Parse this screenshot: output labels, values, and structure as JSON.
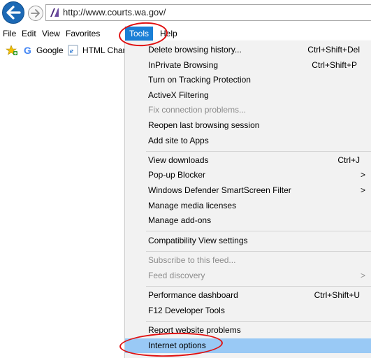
{
  "address_bar": {
    "url": "http://www.courts.wa.gov/",
    "back_icon": "back-arrow-icon",
    "forward_icon": "forward-arrow-icon",
    "site_icon": "site-favicon-icon"
  },
  "menu_bar": {
    "items": [
      {
        "label": "File"
      },
      {
        "label": "Edit"
      },
      {
        "label": "View"
      },
      {
        "label": "Favorites"
      },
      {
        "label": "Tools"
      },
      {
        "label": "Help"
      }
    ],
    "active": "Tools"
  },
  "favorites_bar": {
    "items": [
      {
        "label": "Google",
        "icon": "google-icon"
      },
      {
        "label": "HTML Char",
        "icon": "ie-page-icon"
      }
    ],
    "add_icon": "add-favorites-star-icon"
  },
  "tools_menu": {
    "items": [
      {
        "label": "Delete browsing history...",
        "shortcut": "Ctrl+Shift+Del"
      },
      {
        "label": "InPrivate Browsing",
        "shortcut": "Ctrl+Shift+P"
      },
      {
        "label": "Turn on Tracking Protection"
      },
      {
        "label": "ActiveX Filtering"
      },
      {
        "label": "Fix connection problems..."
      },
      {
        "label": "Reopen last browsing session"
      },
      {
        "label": "Add site to Apps"
      },
      {
        "label": "View downloads",
        "shortcut": "Ctrl+J"
      },
      {
        "label": "Pop-up Blocker",
        "submenu_arrow": ">"
      },
      {
        "label": "Windows Defender SmartScreen Filter",
        "submenu_arrow": ">"
      },
      {
        "label": "Manage media licenses"
      },
      {
        "label": "Manage add-ons"
      },
      {
        "label": "Compatibility View settings"
      },
      {
        "label": "Subscribe to this feed..."
      },
      {
        "label": "Feed discovery",
        "submenu_arrow": ">"
      },
      {
        "label": "Performance dashboard",
        "shortcut": "Ctrl+Shift+U"
      },
      {
        "label": "F12 Developer Tools"
      },
      {
        "label": "Report website problems"
      },
      {
        "label": "Internet options"
      }
    ],
    "disabled": [
      "Fix connection problems...",
      "Subscribe to this feed...",
      "Feed discovery"
    ],
    "highlighted": "Internet options"
  },
  "colors": {
    "menu_active_bg": "#1a7fd6",
    "item_highlight_bg": "#99c9f5",
    "annotation_red": "#e01010",
    "disabled_text": "#8d8d8d"
  }
}
